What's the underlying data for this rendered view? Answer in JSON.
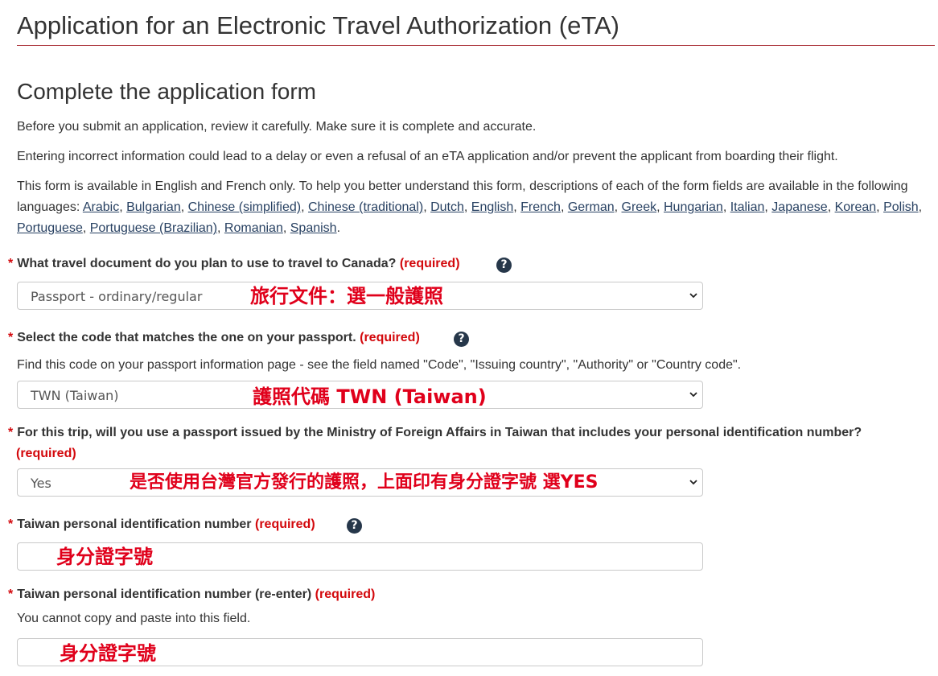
{
  "page": {
    "title": "Application for an Electronic Travel Authorization (eTA)",
    "section_title": "Complete the application form",
    "intro_1": "Before you submit an application, review it carefully. Make sure it is complete and accurate.",
    "intro_2": "Entering incorrect information could lead to a delay or even a refusal of an eTA application and/or prevent the applicant from boarding their flight.",
    "languages_lead": "This form is available in English and French only. To help you better understand this form, descriptions of each of the form fields are available in the following languages: ",
    "languages": [
      "Arabic",
      "Bulgarian",
      "Chinese (simplified)",
      "Chinese (traditional)",
      "Dutch",
      "English",
      "French",
      "German",
      "Greek",
      "Hungarian",
      "Italian",
      "Japanese",
      "Korean",
      "Polish",
      "Portuguese",
      "Portuguese (Brazilian)",
      "Romanian",
      "Spanish"
    ]
  },
  "fields": {
    "travel_doc": {
      "star": "*",
      "label": "What travel document do you plan to use to travel to Canada?",
      "required": "(required)",
      "help_icon": "question-circle-icon",
      "help_glyph": "?",
      "value": "Passport - ordinary/regular",
      "annotation": "旅行文件：選一般護照"
    },
    "passport_code": {
      "star": "*",
      "label": "Select the code that matches the one on your passport.",
      "required": "(required)",
      "help_glyph": "?",
      "hint": "Find this code on your passport information page - see the field named \"Code\", \"Issuing country\", \"Authority\" or \"Country code\".",
      "value": "TWN (Taiwan)",
      "annotation": "護照代碼 TWN (Taiwan)"
    },
    "taiwan_passport": {
      "star": "*",
      "label": "For this trip, will you use a passport issued by the Ministry of Foreign Affairs in Taiwan that includes your personal identification number?",
      "required": "(required)",
      "value": "Yes",
      "annotation": "是否使用台灣官方發行的護照，上面印有身分證字號 選YES"
    },
    "taiwan_id": {
      "star": "*",
      "label": "Taiwan personal identification number",
      "required": "(required)",
      "help_glyph": "?",
      "annotation": "身分證字號"
    },
    "taiwan_id_reenter": {
      "star": "*",
      "label": "Taiwan personal identification number (re-enter)",
      "required": "(required)",
      "hint": "You cannot copy and paste into this field.",
      "annotation": "身分證字號"
    }
  },
  "colors": {
    "accent_rule": "#af3c43",
    "required_red": "#d3080c",
    "annotation_red": "#e0001b",
    "link": "#284162",
    "help_icon_bg": "#26374a"
  }
}
